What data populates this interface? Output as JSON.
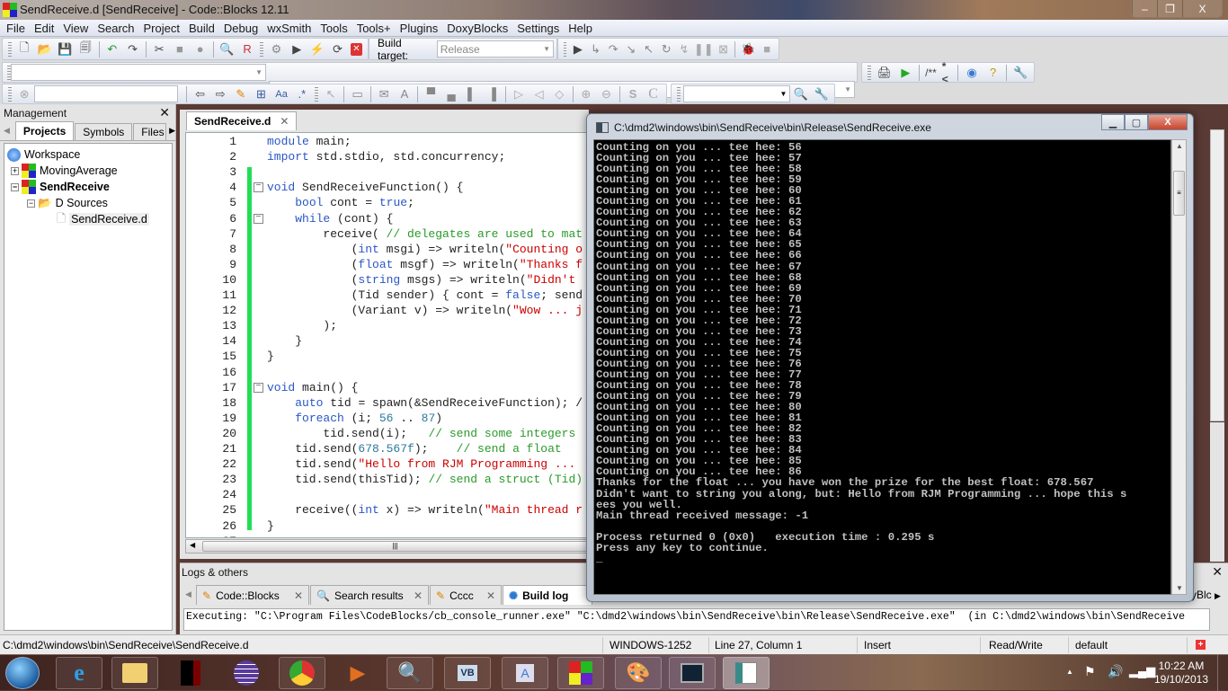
{
  "window": {
    "title": "SendReceive.d [SendReceive] - Code::Blocks 12.11",
    "controls": {
      "minimize": "–",
      "restore": "❐",
      "close": "X"
    }
  },
  "menu": [
    "File",
    "Edit",
    "View",
    "Search",
    "Project",
    "Build",
    "Debug",
    "wxSmith",
    "Tools",
    "Tools+",
    "Plugins",
    "DoxyBlocks",
    "Settings",
    "Help"
  ],
  "toolbar": {
    "build_target_label": "Build target:",
    "build_target_value": "Release",
    "doxy_block_label": "/**",
    "doxy_line_label": "*<",
    "code_completion_combo_left": "",
    "code_completion_combo_right": "",
    "search_input": "",
    "search_combo": ""
  },
  "management": {
    "title": "Management",
    "tabs": [
      "Projects",
      "Symbols",
      "Files"
    ],
    "active_tab": "Projects",
    "tree": [
      {
        "label": "Workspace",
        "type": "workspace"
      },
      {
        "label": "MovingAverage",
        "type": "project",
        "expanded": false
      },
      {
        "label": "SendReceive",
        "type": "project",
        "expanded": true,
        "active": true
      },
      {
        "label": "D Sources",
        "type": "folder"
      },
      {
        "label": "SendReceive.d",
        "type": "file"
      }
    ]
  },
  "editor": {
    "tab_label": "SendReceive.d",
    "lines": [
      {
        "n": "1",
        "code": "module main;"
      },
      {
        "n": "2",
        "code": "import std.stdio, std.concurrency;"
      },
      {
        "n": "3",
        "code": ""
      },
      {
        "n": "4",
        "code": "void SendReceiveFunction() {"
      },
      {
        "n": "5",
        "code": "    bool cont = true;"
      },
      {
        "n": "6",
        "code": "    while (cont) {"
      },
      {
        "n": "7",
        "code": "        receive( // delegates are used to mat"
      },
      {
        "n": "8",
        "code": "            (int msgi) => writeln(\"Counting o"
      },
      {
        "n": "9",
        "code": "            (float msgf) => writeln(\"Thanks f"
      },
      {
        "n": "10",
        "code": "            (string msgs) => writeln(\"Didn't"
      },
      {
        "n": "11",
        "code": "            (Tid sender) { cont = false; send"
      },
      {
        "n": "12",
        "code": "            (Variant v) => writeln(\"Wow ... j"
      },
      {
        "n": "13",
        "code": "        );"
      },
      {
        "n": "14",
        "code": "    }"
      },
      {
        "n": "15",
        "code": "}"
      },
      {
        "n": "16",
        "code": ""
      },
      {
        "n": "17",
        "code": "void main() {"
      },
      {
        "n": "18",
        "code": "    auto tid = spawn(&SendReceiveFunction); /"
      },
      {
        "n": "19",
        "code": "    foreach (i; 56 .. 87)"
      },
      {
        "n": "20",
        "code": "        tid.send(i);   // send some integers"
      },
      {
        "n": "21",
        "code": "    tid.send(678.567f);    // send a float"
      },
      {
        "n": "22",
        "code": "    tid.send(\"Hello from RJM Programming ..."
      },
      {
        "n": "23",
        "code": "    tid.send(thisTid); // send a struct (Tid)"
      },
      {
        "n": "24",
        "code": ""
      },
      {
        "n": "25",
        "code": "    receive((int x) => writeln(\"Main thread r"
      },
      {
        "n": "26",
        "code": "}"
      },
      {
        "n": "27",
        "code": ""
      }
    ]
  },
  "console": {
    "title": "C:\\dmd2\\windows\\bin\\SendReceive\\bin\\Release\\SendReceive.exe",
    "counting_prefix": "Counting on you ... tee hee: ",
    "counting_from": 56,
    "counting_to": 86,
    "tail_lines": [
      "Thanks for the float ... you have won the prize for the best float: 678.567",
      "Didn't want to string you along, but: Hello from RJM Programming ... hope this s",
      "ees you well.",
      "Main thread received message: -1",
      "",
      "Process returned 0 (0x0)   execution time : 0.295 s",
      "Press any key to continue.",
      "_"
    ]
  },
  "logs": {
    "title": "Logs & others",
    "tabs": [
      "Code::Blocks",
      "Search results",
      "Cccc",
      "Build log"
    ],
    "active_tab": "Build log",
    "overflow_tab_fragment": "yBlc",
    "text": "Executing: \"C:\\Program Files\\CodeBlocks/cb_console_runner.exe\" \"C:\\dmd2\\windows\\bin\\SendReceive\\bin\\Release\\SendReceive.exe\"  (in C:\\dmd2\\windows\\bin\\SendReceive"
  },
  "statusbar": {
    "path": "C:\\dmd2\\windows\\bin\\SendReceive\\SendReceive.d",
    "encoding": "WINDOWS-1252",
    "position": "Line 27, Column 1",
    "mode": "Insert",
    "access": "Read/Write",
    "profile": "default"
  },
  "taskbar": {
    "apps": [
      "start",
      "internet-explorer",
      "file-explorer",
      "terminal-app",
      "eclipse",
      "chrome",
      "media-player",
      "search",
      "visual-basic",
      "wordpad",
      "codeblocks",
      "paint",
      "task-manager",
      "console-window"
    ],
    "time": "10:22 AM",
    "date": "19/10/2013"
  },
  "colors": {
    "keyword": "#2a56c6",
    "comment": "#2a9a2a",
    "string": "#c00000",
    "number": "#2a7a9a",
    "changebar": "#22dd55"
  }
}
